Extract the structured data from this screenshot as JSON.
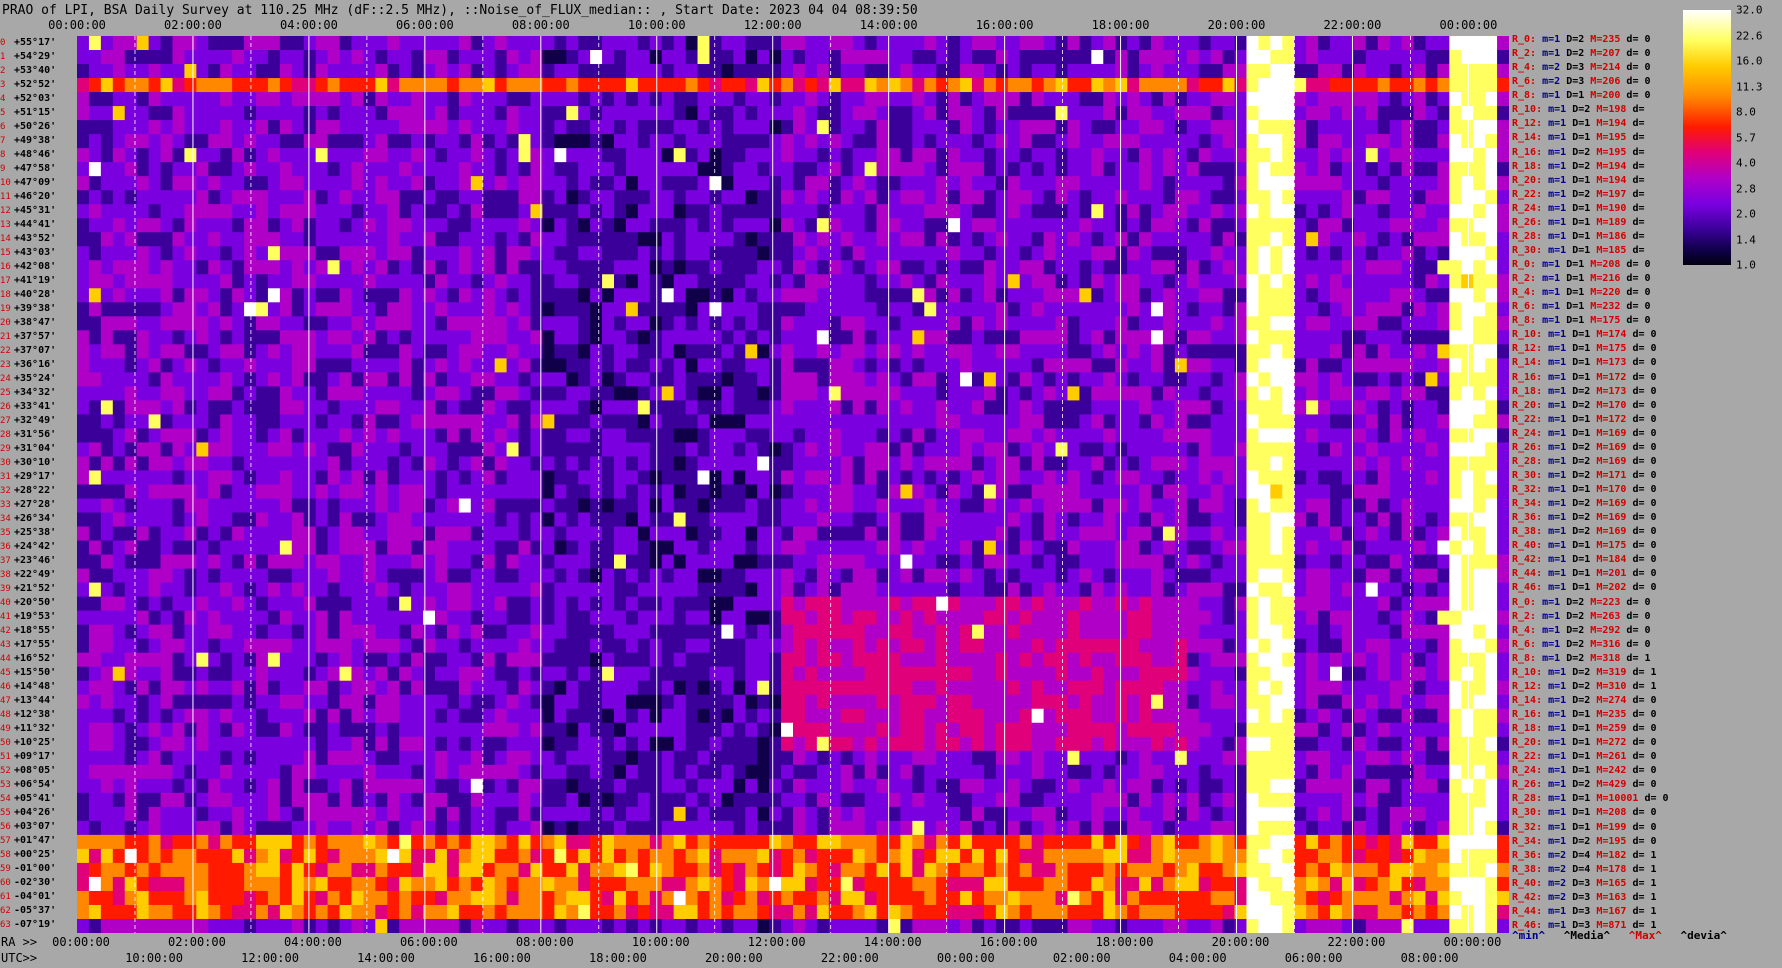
{
  "title": "PRAO of LPI, BSA Daily Survey at 110.25 MHz (dF::2.5 MHz), ::Noise_of_FLUX_median:: , Start Date: 2023 04 04 08:39:50",
  "chart_data": {
    "type": "heatmap",
    "title": "PRAO of LPI, BSA Daily Survey at 110.25 MHz (dF::2.5 MHz), ::Noise_of_FLUX_median:: , Start Date: 2023 04 04 08:39:50",
    "x_top_ticks": [
      "00:00:00",
      "02:00:00",
      "04:00:00",
      "06:00:00",
      "08:00:00",
      "10:00:00",
      "12:00:00",
      "14:00:00",
      "16:00:00",
      "18:00:00",
      "20:00:00",
      "22:00:00",
      "00:00:00"
    ],
    "ra_ticks": [
      "00:00:00",
      "02:00:00",
      "04:00:00",
      "06:00:00",
      "08:00:00",
      "10:00:00",
      "12:00:00",
      "14:00:00",
      "16:00:00",
      "18:00:00",
      "20:00:00",
      "22:00:00",
      "00:00:00"
    ],
    "ra_prefix": "RA >>",
    "utc_prefix": "UTC>>",
    "utc_ticks": [
      "10:00:00",
      "12:00:00",
      "14:00:00",
      "16:00:00",
      "18:00:00",
      "20:00:00",
      "22:00:00",
      "00:00:00",
      "02:00:00",
      "04:00:00",
      "06:00:00",
      "08:00:00"
    ],
    "colorbar": {
      "ticks": [
        "32.0",
        "22.6",
        "16.0",
        "11.3",
        "8.0",
        "5.7",
        "4.0",
        "2.8",
        "2.0",
        "1.4",
        "1.0"
      ],
      "range": [
        1.0,
        32.0
      ],
      "scale": "log",
      "colors": [
        "#000010",
        "#10004a",
        "#3a0099",
        "#7a00e0",
        "#b000c8",
        "#e0007a",
        "#ff1a00",
        "#ff8800",
        "#ffcc00",
        "#ffff60",
        "#ffffff"
      ]
    },
    "declinations": [
      {
        "i": "0",
        "v": "+55°17'"
      },
      {
        "i": "1",
        "v": "+54°29'"
      },
      {
        "i": "2",
        "v": "+53°40'"
      },
      {
        "i": "3",
        "v": "+52°52'"
      },
      {
        "i": "4",
        "v": "+52°03'"
      },
      {
        "i": "5",
        "v": "+51°15'"
      },
      {
        "i": "6",
        "v": "+50°26'"
      },
      {
        "i": "7",
        "v": "+49°38'"
      },
      {
        "i": "8",
        "v": "+48°46'"
      },
      {
        "i": "9",
        "v": "+47°58'"
      },
      {
        "i": "10",
        "v": "+47°09'"
      },
      {
        "i": "11",
        "v": "+46°20'"
      },
      {
        "i": "12",
        "v": "+45°31'"
      },
      {
        "i": "13",
        "v": "+44°41'"
      },
      {
        "i": "14",
        "v": "+43°52'"
      },
      {
        "i": "15",
        "v": "+43°03'"
      },
      {
        "i": "16",
        "v": "+42°08'"
      },
      {
        "i": "17",
        "v": "+41°19'"
      },
      {
        "i": "18",
        "v": "+40°28'"
      },
      {
        "i": "19",
        "v": "+39°38'"
      },
      {
        "i": "20",
        "v": "+38°47'"
      },
      {
        "i": "21",
        "v": "+37°57'"
      },
      {
        "i": "22",
        "v": "+37°07'"
      },
      {
        "i": "23",
        "v": "+36°16'"
      },
      {
        "i": "24",
        "v": "+35°24'"
      },
      {
        "i": "25",
        "v": "+34°32'"
      },
      {
        "i": "26",
        "v": "+33°41'"
      },
      {
        "i": "27",
        "v": "+32°49'"
      },
      {
        "i": "28",
        "v": "+31°56'"
      },
      {
        "i": "29",
        "v": "+31°04'"
      },
      {
        "i": "30",
        "v": "+30°10'"
      },
      {
        "i": "31",
        "v": "+29°17'"
      },
      {
        "i": "32",
        "v": "+28°22'"
      },
      {
        "i": "33",
        "v": "+27°28'"
      },
      {
        "i": "34",
        "v": "+26°34'"
      },
      {
        "i": "35",
        "v": "+25°38'"
      },
      {
        "i": "36",
        "v": "+24°42'"
      },
      {
        "i": "37",
        "v": "+23°46'"
      },
      {
        "i": "38",
        "v": "+22°49'"
      },
      {
        "i": "39",
        "v": "+21°52'"
      },
      {
        "i": "40",
        "v": "+20°50'"
      },
      {
        "i": "41",
        "v": "+19°53'"
      },
      {
        "i": "42",
        "v": "+18°55'"
      },
      {
        "i": "43",
        "v": "+17°55'"
      },
      {
        "i": "44",
        "v": "+16°52'"
      },
      {
        "i": "45",
        "v": "+15°50'"
      },
      {
        "i": "46",
        "v": "+14°48'"
      },
      {
        "i": "47",
        "v": "+13°44'"
      },
      {
        "i": "48",
        "v": "+12°38'"
      },
      {
        "i": "49",
        "v": "+11°32'"
      },
      {
        "i": "50",
        "v": "+10°25'"
      },
      {
        "i": "51",
        "v": "+09°17'"
      },
      {
        "i": "52",
        "v": "+08°05'"
      },
      {
        "i": "53",
        "v": "+06°54'"
      },
      {
        "i": "54",
        "v": "+05°41'"
      },
      {
        "i": "55",
        "v": "+04°26'"
      },
      {
        "i": "56",
        "v": "+03°07'"
      },
      {
        "i": "57",
        "v": "+01°47'"
      },
      {
        "i": "58",
        "v": "+00°25'"
      },
      {
        "i": "59",
        "v": "-01°00'"
      },
      {
        "i": "60",
        "v": "-02°30'"
      },
      {
        "i": "61",
        "v": "-04°01'"
      },
      {
        "i": "62",
        "v": "-05°37'"
      },
      {
        "i": "63",
        "v": "-07°19'"
      }
    ],
    "row_stats": [
      {
        "r": "R_0:",
        "m": "m=1",
        "D": "D=2",
        "M": "M=235",
        "d": "d= 0"
      },
      {
        "r": "R_2:",
        "m": "m=1",
        "D": "D=2",
        "M": "M=207",
        "d": "d= 0"
      },
      {
        "r": "R_4:",
        "m": "m=2",
        "D": "D=3",
        "M": "M=214",
        "d": "d= 0"
      },
      {
        "r": "R_6:",
        "m": "m=2",
        "D": "D=3",
        "M": "M=206",
        "d": "d= 0"
      },
      {
        "r": "R_8:",
        "m": "m=1",
        "D": "D=1",
        "M": "M=200",
        "d": "d= 0"
      },
      {
        "r": "R_10:",
        "m": "m=1",
        "D": "D=2",
        "M": "M=198",
        "d": "d="
      },
      {
        "r": "R_12:",
        "m": "m=1",
        "D": "D=1",
        "M": "M=194",
        "d": "d="
      },
      {
        "r": "R_14:",
        "m": "m=1",
        "D": "D=1",
        "M": "M=195",
        "d": "d="
      },
      {
        "r": "R_16:",
        "m": "m=1",
        "D": "D=2",
        "M": "M=195",
        "d": "d="
      },
      {
        "r": "R_18:",
        "m": "m=1",
        "D": "D=2",
        "M": "M=194",
        "d": "d="
      },
      {
        "r": "R_20:",
        "m": "m=1",
        "D": "D=1",
        "M": "M=194",
        "d": "d="
      },
      {
        "r": "R_22:",
        "m": "m=1",
        "D": "D=2",
        "M": "M=197",
        "d": "d="
      },
      {
        "r": "R_24:",
        "m": "m=1",
        "D": "D=1",
        "M": "M=190",
        "d": "d="
      },
      {
        "r": "R_26:",
        "m": "m=1",
        "D": "D=1",
        "M": "M=189",
        "d": "d="
      },
      {
        "r": "R_28:",
        "m": "m=1",
        "D": "D=1",
        "M": "M=186",
        "d": "d="
      },
      {
        "r": "R_30:",
        "m": "m=1",
        "D": "D=1",
        "M": "M=185",
        "d": "d="
      },
      {
        "r": "R_0:",
        "m": "m=1",
        "D": "D=1",
        "M": "M=208",
        "d": "d= 0"
      },
      {
        "r": "R_2:",
        "m": "m=1",
        "D": "D=1",
        "M": "M=216",
        "d": "d= 0"
      },
      {
        "r": "R_4:",
        "m": "m=1",
        "D": "D=1",
        "M": "M=220",
        "d": "d= 0"
      },
      {
        "r": "R_6:",
        "m": "m=1",
        "D": "D=1",
        "M": "M=232",
        "d": "d= 0"
      },
      {
        "r": "R_8:",
        "m": "m=1",
        "D": "D=1",
        "M": "M=175",
        "d": "d= 0"
      },
      {
        "r": "R_10:",
        "m": "m=1",
        "D": "D=1",
        "M": "M=174",
        "d": "d= 0"
      },
      {
        "r": "R_12:",
        "m": "m=1",
        "D": "D=1",
        "M": "M=175",
        "d": "d= 0"
      },
      {
        "r": "R_14:",
        "m": "m=1",
        "D": "D=1",
        "M": "M=173",
        "d": "d= 0"
      },
      {
        "r": "R_16:",
        "m": "m=1",
        "D": "D=1",
        "M": "M=172",
        "d": "d= 0"
      },
      {
        "r": "R_18:",
        "m": "m=1",
        "D": "D=2",
        "M": "M=173",
        "d": "d= 0"
      },
      {
        "r": "R_20:",
        "m": "m=1",
        "D": "D=2",
        "M": "M=170",
        "d": "d= 0"
      },
      {
        "r": "R_22:",
        "m": "m=1",
        "D": "D=1",
        "M": "M=172",
        "d": "d= 0"
      },
      {
        "r": "R_24:",
        "m": "m=1",
        "D": "D=1",
        "M": "M=169",
        "d": "d= 0"
      },
      {
        "r": "R_26:",
        "m": "m=1",
        "D": "D=2",
        "M": "M=169",
        "d": "d= 0"
      },
      {
        "r": "R_28:",
        "m": "m=1",
        "D": "D=2",
        "M": "M=169",
        "d": "d= 0"
      },
      {
        "r": "R_30:",
        "m": "m=1",
        "D": "D=2",
        "M": "M=171",
        "d": "d= 0"
      },
      {
        "r": "R_32:",
        "m": "m=1",
        "D": "D=1",
        "M": "M=170",
        "d": "d= 0"
      },
      {
        "r": "R_34:",
        "m": "m=1",
        "D": "D=2",
        "M": "M=169",
        "d": "d= 0"
      },
      {
        "r": "R_36:",
        "m": "m=1",
        "D": "D=2",
        "M": "M=169",
        "d": "d= 0"
      },
      {
        "r": "R_38:",
        "m": "m=1",
        "D": "D=2",
        "M": "M=169",
        "d": "d= 0"
      },
      {
        "r": "R_40:",
        "m": "m=1",
        "D": "D=1",
        "M": "M=175",
        "d": "d= 0"
      },
      {
        "r": "R_42:",
        "m": "m=1",
        "D": "D=1",
        "M": "M=184",
        "d": "d= 0"
      },
      {
        "r": "R_44:",
        "m": "m=1",
        "D": "D=1",
        "M": "M=201",
        "d": "d= 0"
      },
      {
        "r": "R_46:",
        "m": "m=1",
        "D": "D=1",
        "M": "M=202",
        "d": "d= 0"
      },
      {
        "r": "R_0:",
        "m": "m=1",
        "D": "D=2",
        "M": "M=223",
        "d": "d= 0"
      },
      {
        "r": "R_2:",
        "m": "m=1",
        "D": "D=2",
        "M": "M=263",
        "d": "d= 0"
      },
      {
        "r": "R_4:",
        "m": "m=1",
        "D": "D=2",
        "M": "M=292",
        "d": "d= 0"
      },
      {
        "r": "R_6:",
        "m": "m=1",
        "D": "D=2",
        "M": "M=316",
        "d": "d= 0"
      },
      {
        "r": "R_8:",
        "m": "m=1",
        "D": "D=2",
        "M": "M=318",
        "d": "d= 1"
      },
      {
        "r": "R_10:",
        "m": "m=1",
        "D": "D=2",
        "M": "M=319",
        "d": "d= 1"
      },
      {
        "r": "R_12:",
        "m": "m=1",
        "D": "D=2",
        "M": "M=310",
        "d": "d= 1"
      },
      {
        "r": "R_14:",
        "m": "m=1",
        "D": "D=2",
        "M": "M=274",
        "d": "d= 0"
      },
      {
        "r": "R_16:",
        "m": "m=1",
        "D": "D=1",
        "M": "M=235",
        "d": "d= 0"
      },
      {
        "r": "R_18:",
        "m": "m=1",
        "D": "D=1",
        "M": "M=259",
        "d": "d= 0"
      },
      {
        "r": "R_20:",
        "m": "m=1",
        "D": "D=1",
        "M": "M=272",
        "d": "d= 0"
      },
      {
        "r": "R_22:",
        "m": "m=1",
        "D": "D=1",
        "M": "M=261",
        "d": "d= 0"
      },
      {
        "r": "R_24:",
        "m": "m=1",
        "D": "D=1",
        "M": "M=242",
        "d": "d= 0"
      },
      {
        "r": "R_26:",
        "m": "m=1",
        "D": "D=2",
        "M": "M=429",
        "d": "d= 0"
      },
      {
        "r": "R_28:",
        "m": "m=1",
        "D": "D=1",
        "M": "M=10001",
        "d": "d= 0"
      },
      {
        "r": "R_30:",
        "m": "m=1",
        "D": "D=1",
        "M": "M=208",
        "d": "d= 0"
      },
      {
        "r": "R_32:",
        "m": "m=1",
        "D": "D=1",
        "M": "M=199",
        "d": "d= 0"
      },
      {
        "r": "R_34:",
        "m": "m=1",
        "D": "D=2",
        "M": "M=195",
        "d": "d= 0"
      },
      {
        "r": "R_36:",
        "m": "m=2",
        "D": "D=4",
        "M": "M=182",
        "d": "d= 1"
      },
      {
        "r": "R_38:",
        "m": "m=2",
        "D": "D=4",
        "M": "M=178",
        "d": "d= 1"
      },
      {
        "r": "R_40:",
        "m": "m=2",
        "D": "D=3",
        "M": "M=165",
        "d": "d= 1"
      },
      {
        "r": "R_42:",
        "m": "m=2",
        "D": "D=3",
        "M": "M=163",
        "d": "d= 1"
      },
      {
        "r": "R_44:",
        "m": "m=1",
        "D": "D=3",
        "M": "M=167",
        "d": "d= 1"
      },
      {
        "r": "R_46:",
        "m": "m=1",
        "D": "D=3",
        "M": "M=871",
        "d": "d= 1"
      }
    ],
    "stats_legend": [
      "^min^",
      "^Media^",
      "^Max^",
      "^devia^"
    ],
    "bright_bands_ra": [
      [
        20.0,
        20.95
      ],
      [
        23.6,
        24.35
      ]
    ],
    "bright_rows": [
      3,
      57,
      58,
      59,
      60,
      61,
      62
    ]
  }
}
